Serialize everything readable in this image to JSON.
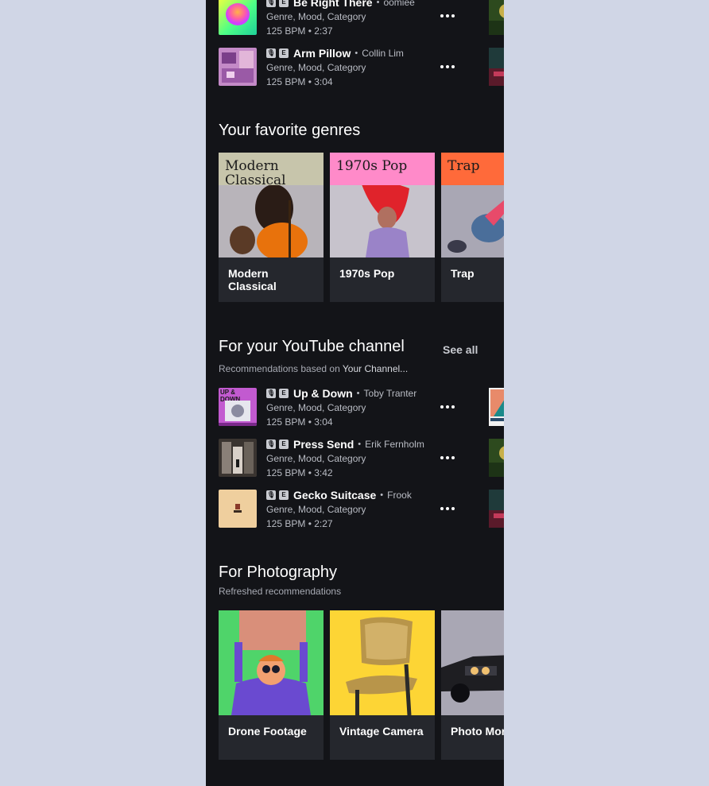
{
  "top_tracks": [
    {
      "title": "Be Right There",
      "artist": "oomiee",
      "meta": "Genre, Mood, Category",
      "info": "125 BPM • 2:37"
    },
    {
      "title": "Arm Pillow",
      "artist": "Collin Lim",
      "meta": "Genre, Mood, Category",
      "info": "125 BPM • 3:04"
    }
  ],
  "badges": {
    "vocal": "🎙",
    "explicit": "E"
  },
  "genres": {
    "title": "Your favorite genres",
    "items": [
      {
        "band": "Modern Classical",
        "label": "Modern Classical"
      },
      {
        "band": "1970s Pop",
        "label": "1970s Pop"
      },
      {
        "band": "Trap",
        "label": "Trap"
      }
    ]
  },
  "youtube": {
    "title": "For your YouTube channel",
    "see_all": "See all",
    "subtitle_prefix": "Recommendations based on",
    "subtitle_channel": "Your Channel...",
    "tracks": [
      {
        "title": "Up & Down",
        "artist": "Toby Tranter",
        "meta": "Genre, Mood, Category",
        "info": "125 BPM • 3:04",
        "art_text": "UP & DOWN"
      },
      {
        "title": "Press Send",
        "artist": "Erik Fernholm",
        "meta": "Genre, Mood, Category",
        "info": "125 BPM • 3:42"
      },
      {
        "title": "Gecko Suitcase",
        "artist": "Frook",
        "meta": "Genre, Mood, Category",
        "info": "125 BPM • 2:27"
      }
    ]
  },
  "photography": {
    "title": "For Photography",
    "subtitle": "Refreshed recommendations",
    "items": [
      {
        "label": "Drone Footage"
      },
      {
        "label": "Vintage Camera"
      },
      {
        "label": "Photo Mor"
      }
    ]
  },
  "colors": {
    "background": "#131418",
    "card": "#25272d",
    "page": "#d0d6e6"
  }
}
